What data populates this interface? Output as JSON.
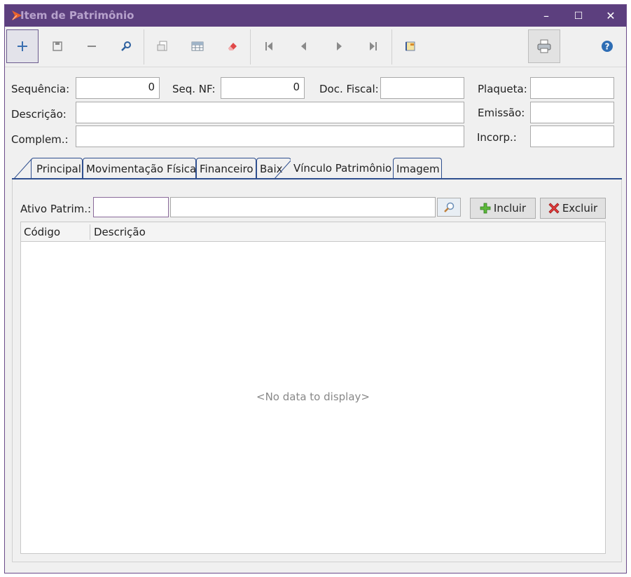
{
  "window": {
    "title": "Item de Patrimônio",
    "minimize": "–",
    "maximize": "☐",
    "close": "✕"
  },
  "toolbar": {
    "items": [
      "add-icon",
      "save-icon",
      "remove-icon",
      "search-icon",
      "txt-export-icon",
      "grid-icon",
      "eraser-icon",
      "first-icon",
      "prev-icon",
      "next-icon",
      "last-icon",
      "report-icon",
      "print-icon",
      "help-icon"
    ]
  },
  "form": {
    "sequencia_label": "Sequência:",
    "sequencia_value": "0",
    "seqnf_label": "Seq. NF:",
    "seqnf_value": "0",
    "docfiscal_label": "Doc. Fiscal:",
    "docfiscal_value": "",
    "plaqueta_label": "Plaqueta:",
    "plaqueta_value": "",
    "descricao_label": "Descrição:",
    "descricao_value": "",
    "emissao_label": "Emissão:",
    "emissao_value": "",
    "complem_label": "Complem.:",
    "complem_value": "",
    "incorp_label": "Incorp.:",
    "incorp_value": ""
  },
  "tabs": [
    "Principal",
    "Movimentação Física",
    "Financeiro",
    "Baix",
    "Vínculo Patrimônio",
    "Imagem"
  ],
  "vinculo": {
    "ativo_label": "Ativo Patrim.:",
    "ativo_code": "",
    "ativo_desc": "",
    "incluir_label": "Incluir",
    "excluir_label": "Excluir",
    "columns": [
      "Código",
      "Descrição"
    ],
    "empty_message": "<No data to display>"
  },
  "colors": {
    "title_bar": "#5c3f7e",
    "tab_border": "#2f4f8f"
  }
}
